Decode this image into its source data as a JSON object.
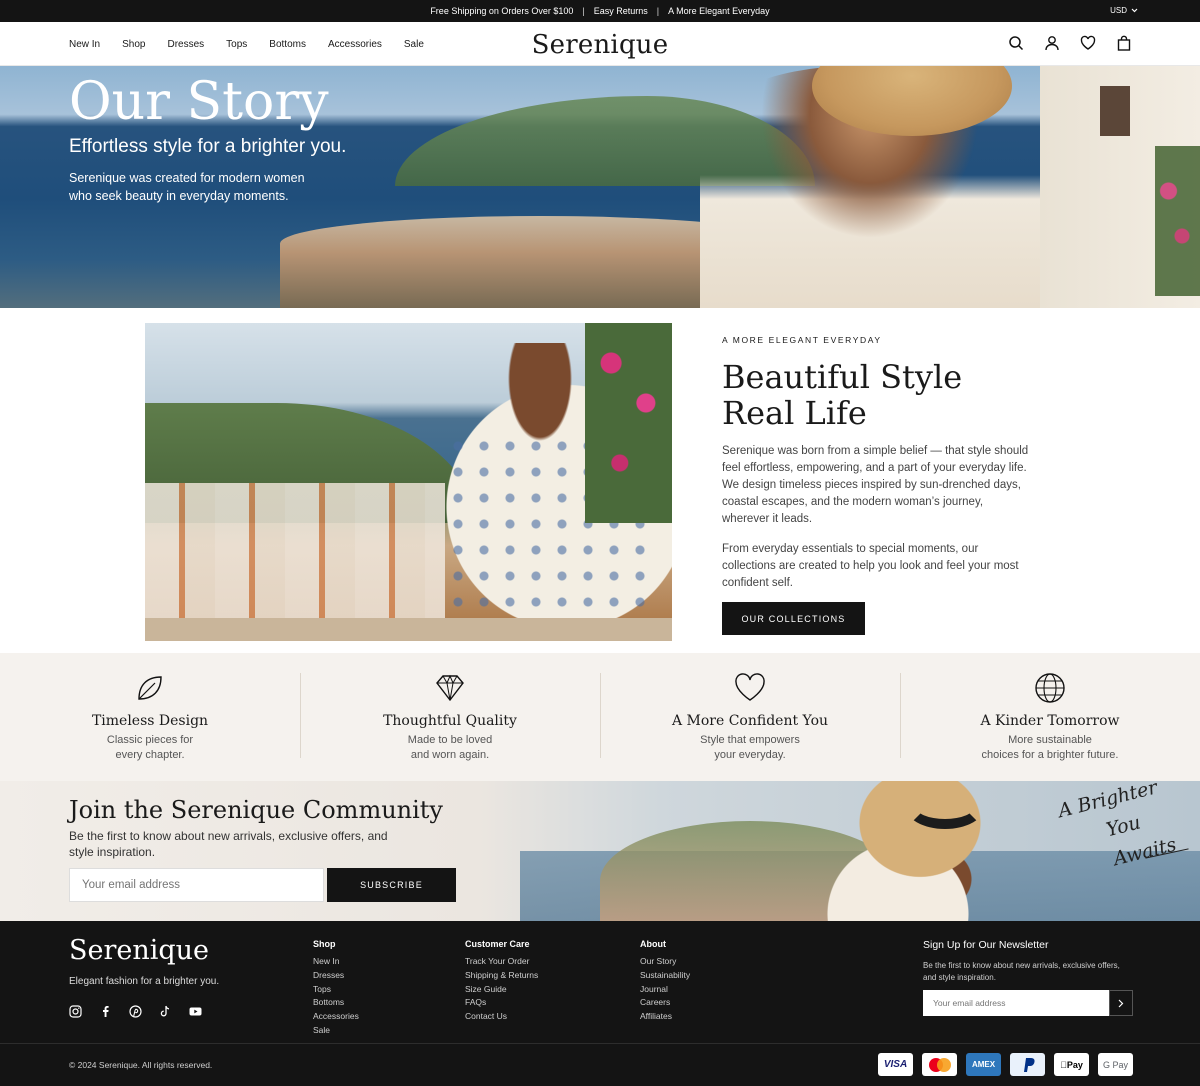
{
  "announcement": {
    "items": [
      "Free Shipping on Orders Over $100",
      "Easy Returns",
      "A More Elegant Everyday"
    ],
    "separator": "|",
    "currency": "USD"
  },
  "header": {
    "nav": [
      "New In",
      "Shop",
      "Dresses",
      "Tops",
      "Bottoms",
      "Accessories",
      "Sale"
    ],
    "logo": "Serenique",
    "icons": [
      "search-icon",
      "account-icon",
      "wishlist-icon",
      "cart-icon"
    ]
  },
  "hero": {
    "title": "Our Story",
    "subtitle": "Effortless style for a brighter you.",
    "desc_line1": "Serenique was created for modern women",
    "desc_line2": "who seek beauty in everyday moments."
  },
  "story": {
    "eyebrow": "A MORE ELEGANT EVERYDAY",
    "title_line1": "Beautiful Style",
    "title_line2": "Real Life",
    "p1": "Serenique was born from a simple belief — that style should feel effortless, empowering, and a part of your everyday life. We design timeless pieces inspired by sun-drenched days, coastal escapes, and the modern woman’s journey, wherever it leads.",
    "p2": "From everyday essentials to special moments, our collections are created to help you look and feel your most confident self.",
    "button": "OUR COLLECTIONS"
  },
  "values": [
    {
      "icon": "leaf-icon",
      "title": "Timeless Design",
      "line1": "Classic pieces for",
      "line2": "every chapter."
    },
    {
      "icon": "diamond-icon",
      "title": "Thoughtful Quality",
      "line1": "Made to be loved",
      "line2": "and worn again."
    },
    {
      "icon": "heart-icon",
      "title": "A More Confident You",
      "line1": "Style that empowers",
      "line2": "your everyday."
    },
    {
      "icon": "globe-icon",
      "title": "A Kinder Tomorrow",
      "line1": "More sustainable",
      "line2": "choices for a brighter future."
    }
  ],
  "community": {
    "title": "Join the Serenique Community",
    "desc": "Be the first to know about new arrivals, exclusive offers, and style inspiration.",
    "placeholder": "Your email address",
    "button": "SUBSCRIBE",
    "script_line1": "A Brighter",
    "script_line2": "You Awaits"
  },
  "footer": {
    "logo": "Serenique",
    "tagline": "Elegant fashion for a brighter you.",
    "social": [
      "instagram-icon",
      "facebook-icon",
      "pinterest-icon",
      "tiktok-icon",
      "youtube-icon"
    ],
    "columns": [
      {
        "heading": "Shop",
        "items": [
          "New In",
          "Dresses",
          "Tops",
          "Bottoms",
          "Accessories",
          "Sale"
        ]
      },
      {
        "heading": "Customer Care",
        "items": [
          "Track Your Order",
          "Shipping & Returns",
          "Size Guide",
          "FAQs",
          "Contact Us"
        ]
      },
      {
        "heading": "About",
        "items": [
          "Our Story",
          "Sustainability",
          "Journal",
          "Careers",
          "Affiliates"
        ]
      }
    ],
    "newsletter": {
      "heading": "Sign Up for Our Newsletter",
      "desc": "Be the first to know about new arrivals, exclusive offers, and style inspiration.",
      "placeholder": "Your email address"
    },
    "copyright": "© 2024 Serenique. All rights reserved.",
    "payments": [
      "VISA",
      "Mastercard",
      "AMEX",
      "PayPal",
      "Apple Pay",
      "G Pay"
    ]
  }
}
